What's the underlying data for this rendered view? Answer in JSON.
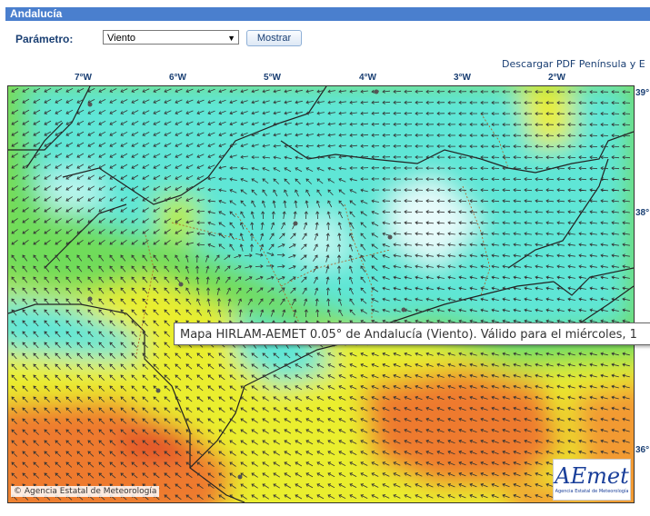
{
  "header": {
    "title": "Andalucía"
  },
  "form": {
    "param_label": "Parámetro:",
    "param_value": "Viento",
    "submit_label": "Mostrar"
  },
  "download_link": "Descargar PDF Península y E",
  "map": {
    "lon_labels": [
      "7°W",
      "6°W",
      "5°W",
      "4°W",
      "3°W",
      "2°W"
    ],
    "lat_labels": [
      "39°",
      "38°",
      "36°"
    ],
    "tooltip": "Mapa HIRLAM-AEMET 0.05° de Andalucía (Viento). Válido para el miércoles, 1",
    "copyright": "Agencia Estatal de Meteorología",
    "logo_text": "AEmet",
    "logo_sub": "Agencia Estatal de Meteorología",
    "colors": {
      "cyan": "#5ee6d6",
      "green": "#6fdc5a",
      "yellow": "#eaee2e",
      "orange": "#ee7a2e"
    }
  }
}
